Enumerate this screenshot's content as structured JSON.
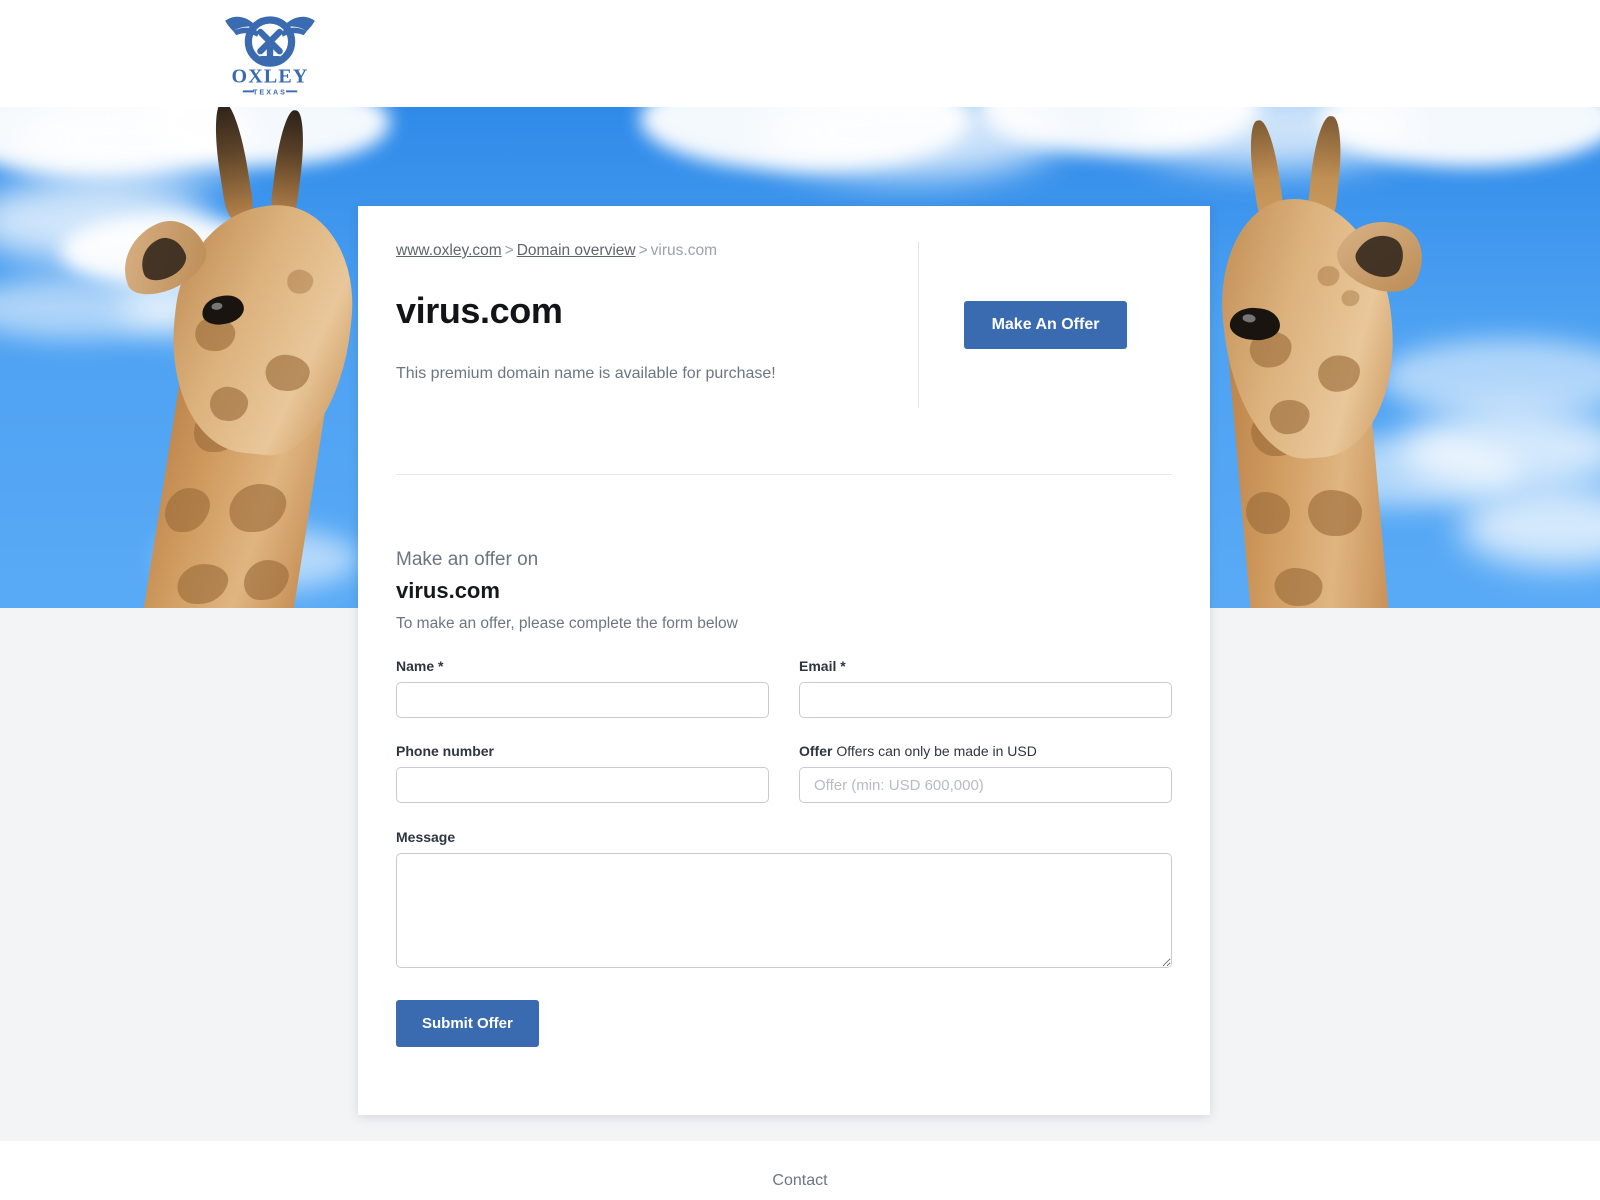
{
  "header": {
    "logo_name": "oxley-longhorn-logo",
    "logo_word": "OXLEY",
    "logo_sub": "TEXAS"
  },
  "hero": {
    "image_alt": "two-giraffes-blue-sky"
  },
  "card": {
    "breadcrumb": {
      "home": "www.oxley.com",
      "sep1": ">",
      "overview": "Domain overview",
      "sep2": ">",
      "current": "virus.com"
    },
    "domain_title": "virus.com",
    "availability": "This premium domain name is available for purchase!",
    "make_offer_button": "Make An Offer"
  },
  "form": {
    "kicker": "Make an offer on",
    "domain": "virus.com",
    "intro": "To make an offer, please complete the form below",
    "fields": {
      "name": {
        "label": "Name",
        "required": "*",
        "value": "",
        "placeholder": ""
      },
      "email": {
        "label": "Email",
        "required": "*",
        "value": "",
        "placeholder": ""
      },
      "phone": {
        "label": "Phone number",
        "value": "",
        "placeholder": ""
      },
      "offer": {
        "label": "Offer",
        "hint": "Offers can only be made in USD",
        "value": "",
        "placeholder": "Offer (min: USD 600,000)"
      },
      "message": {
        "label": "Message",
        "value": "",
        "placeholder": ""
      }
    },
    "submit_button": "Submit Offer"
  },
  "footer": {
    "contact": "Contact"
  },
  "colors": {
    "accent": "#3a6ab0",
    "page_bg": "#f2f4f6",
    "text_muted": "#6b7682",
    "sky": "#4ea2f2"
  }
}
